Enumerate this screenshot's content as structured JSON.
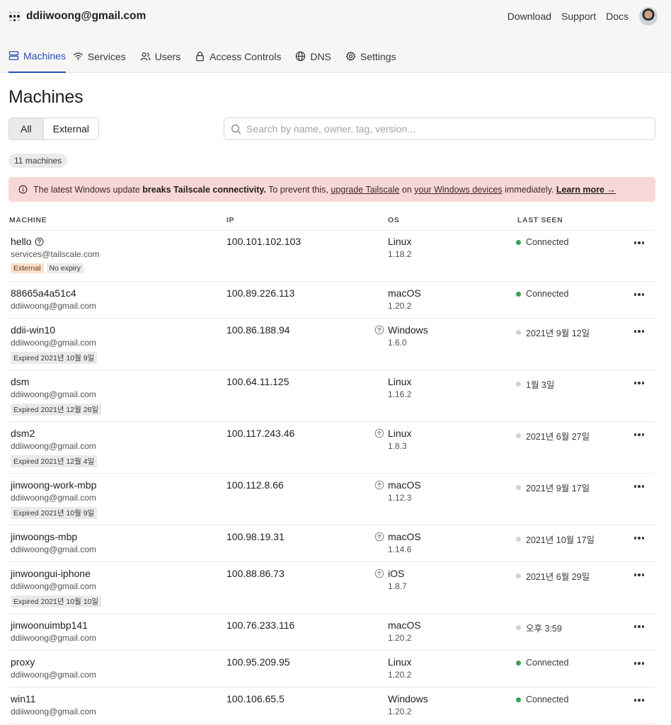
{
  "header": {
    "account": "ddiiwoong@gmail.com",
    "links": [
      "Download",
      "Support",
      "Docs"
    ]
  },
  "nav": [
    {
      "label": "Machines",
      "icon": "machines-icon",
      "active": true
    },
    {
      "label": "Services",
      "icon": "wifi-icon"
    },
    {
      "label": "Users",
      "icon": "users-icon"
    },
    {
      "label": "Access Controls",
      "icon": "lock-icon"
    },
    {
      "label": "DNS",
      "icon": "globe-icon"
    },
    {
      "label": "Settings",
      "icon": "gear-icon"
    }
  ],
  "page": {
    "title": "Machines",
    "filter_all": "All",
    "filter_external": "External",
    "search_placeholder": "Search by name, owner, tag, version...",
    "count": "11 machines"
  },
  "alert": {
    "t1": "The latest Windows update ",
    "b1": "breaks Tailscale connectivity.",
    "t2": " To prevent this, ",
    "l1": "upgrade Tailscale",
    "t3": " on ",
    "l2": "your Windows devices",
    "t4": " immediately. ",
    "l3": "Learn more →"
  },
  "columns": [
    "MACHINE",
    "IP",
    "OS",
    "LAST SEEN"
  ],
  "machines": [
    {
      "name": "hello",
      "help": true,
      "owner": "services@tailscale.com",
      "tags": [
        {
          "label": "External",
          "kind": "ext"
        },
        {
          "label": "No expiry"
        }
      ],
      "ip": "100.101.102.103",
      "os": "Linux",
      "ver": "1.18.2",
      "update": false,
      "seen": "Connected",
      "online": true
    },
    {
      "name": "88665a4a51c4",
      "owner": "ddiiwoong@gmail.com",
      "tags": [],
      "ip": "100.89.226.113",
      "os": "macOS",
      "ver": "1.20.2",
      "update": false,
      "seen": "Connected",
      "online": true
    },
    {
      "name": "ddii-win10",
      "owner": "ddiiwoong@gmail.com",
      "tags": [
        {
          "label": "Expired 2021년 10월 9일"
        }
      ],
      "ip": "100.86.188.94",
      "os": "Windows",
      "ver": "1.6.0",
      "update": true,
      "seen": "2021년 9월 12일",
      "online": false
    },
    {
      "name": "dsm",
      "owner": "ddiiwoong@gmail.com",
      "tags": [
        {
          "label": "Expired 2021년 12월 26일"
        }
      ],
      "ip": "100.64.11.125",
      "os": "Linux",
      "ver": "1.16.2",
      "update": false,
      "seen": "1월 3일",
      "online": false
    },
    {
      "name": "dsm2",
      "owner": "ddiiwoong@gmail.com",
      "tags": [
        {
          "label": "Expired 2021년 12월 4일"
        }
      ],
      "ip": "100.117.243.46",
      "os": "Linux",
      "ver": "1.8.3",
      "update": true,
      "seen": "2021년 6월 27일",
      "online": false
    },
    {
      "name": "jinwoong-work-mbp",
      "owner": "ddiiwoong@gmail.com",
      "tags": [
        {
          "label": "Expired 2021년 10월 9일"
        }
      ],
      "ip": "100.112.8.66",
      "os": "macOS",
      "ver": "1.12.3",
      "update": true,
      "seen": "2021년 9월 17일",
      "online": false
    },
    {
      "name": "jinwoongs-mbp",
      "owner": "ddiiwoong@gmail.com",
      "tags": [],
      "ip": "100.98.19.31",
      "os": "macOS",
      "ver": "1.14.6",
      "update": true,
      "seen": "2021년 10월 17일",
      "online": false
    },
    {
      "name": "jinwoongui-iphone",
      "owner": "ddiiwoong@gmail.com",
      "tags": [
        {
          "label": "Expired 2021년 10월 10일"
        }
      ],
      "ip": "100.88.86.73",
      "os": "iOS",
      "ver": "1.8.7",
      "update": true,
      "seen": "2021년 6월 29일",
      "online": false
    },
    {
      "name": "jinwoonuimbp141",
      "owner": "ddiiwoong@gmail.com",
      "tags": [],
      "ip": "100.76.233.116",
      "os": "macOS",
      "ver": "1.20.2",
      "update": false,
      "seen": "오후 3:59",
      "online": false
    },
    {
      "name": "proxy",
      "owner": "ddiiwoong@gmail.com",
      "tags": [],
      "ip": "100.95.209.95",
      "os": "Linux",
      "ver": "1.20.2",
      "update": false,
      "seen": "Connected",
      "online": true
    },
    {
      "name": "win11",
      "owner": "ddiiwoong@gmail.com",
      "tags": [],
      "ip": "100.106.65.5",
      "os": "Windows",
      "ver": "1.20.2",
      "update": false,
      "seen": "Connected",
      "online": true
    }
  ]
}
